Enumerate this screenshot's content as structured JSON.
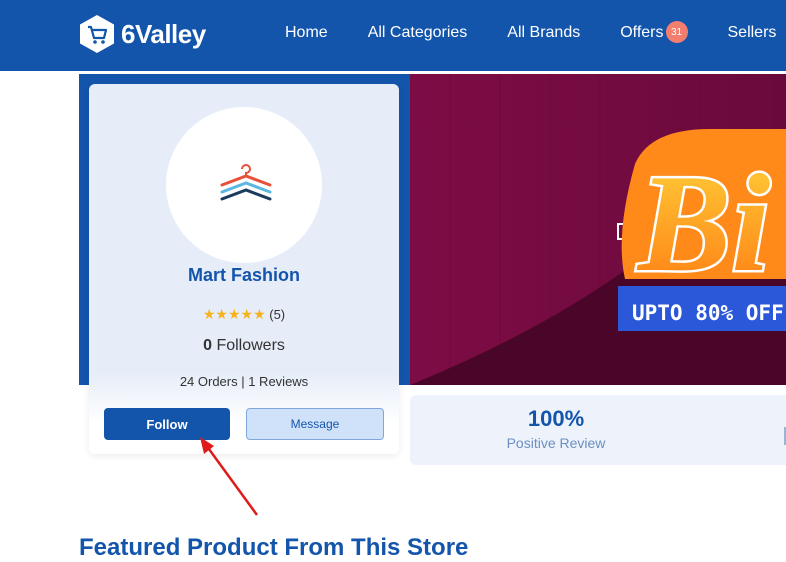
{
  "header": {
    "brand": "6Valley",
    "nav": [
      {
        "label": "Home"
      },
      {
        "label": "All Categories"
      },
      {
        "label": "All Brands"
      },
      {
        "label": "Offers",
        "badge": "31"
      },
      {
        "label": "Sellers"
      }
    ]
  },
  "shop": {
    "name": "Mart Fashion",
    "rating_count": "(5)",
    "followers_count": "0",
    "followers_label": "Followers",
    "orders_reviews": "24 Orders | 1 Reviews",
    "follow_label": "Follow",
    "message_label": "Message"
  },
  "banner": {
    "headline": "Bi",
    "offer_text": "UPTO 80% OFF"
  },
  "stats": {
    "value": "100%",
    "label": "Positive Review"
  },
  "section": {
    "title": "Featured Product From This Store"
  },
  "colors": {
    "primary": "#1455ac",
    "badge": "#f47e6e",
    "star": "#f5b21b"
  }
}
